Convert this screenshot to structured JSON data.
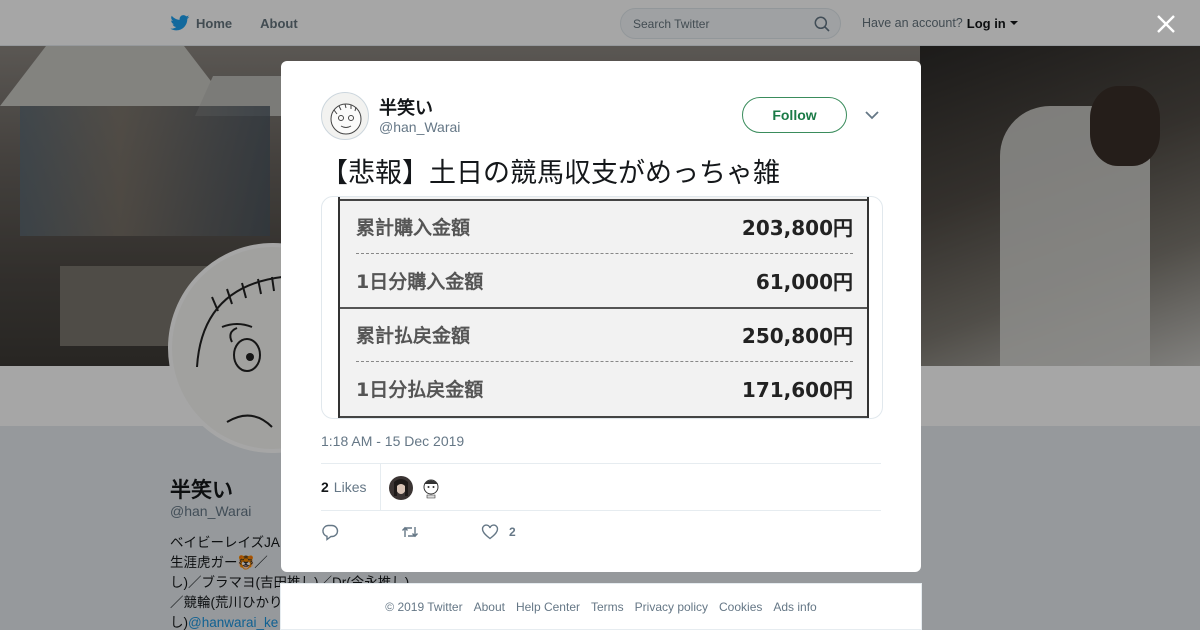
{
  "topbar": {
    "home_label": "Home",
    "about_label": "About",
    "search_placeholder": "Search Twitter",
    "have_account": "Have an account?",
    "login_label": "Log in"
  },
  "profile": {
    "name": "半笑い",
    "handle": "@han_Warai",
    "bio_lines": [
      "ベイビーレイズJA",
      "生涯虎ガー🐯／",
      "し)／ブラマヨ(吉田推し)／Dr(今永推し)",
      "／競輪(荒川ひかり",
      "し)"
    ],
    "bio_link": "@hanwarai_ke"
  },
  "tweet": {
    "author_name": "半笑い",
    "author_handle": "@han_Warai",
    "follow_label": "Follow",
    "text": "【悲報】土日の競馬収支がめっちゃ雑",
    "media_rows": [
      {
        "label": "累計購入金額",
        "value": "203,800円"
      },
      {
        "label": "1日分購入金額",
        "value": "61,000円"
      },
      {
        "label": "累計払戻金額",
        "value": "250,800円"
      },
      {
        "label": "1日分払戻金額",
        "value": "171,600円"
      }
    ],
    "timestamp": "1:18 AM - 15 Dec 2019",
    "likes_count": "2",
    "likes_label": "Likes",
    "like_action_count": "2"
  },
  "footer": {
    "links": [
      "© 2019 Twitter",
      "About",
      "Help Center",
      "Terms",
      "Privacy policy",
      "Cookies",
      "Ads info"
    ]
  },
  "colors": {
    "follow_border": "#3a8c5c",
    "follow_text": "#1a7a46",
    "muted_text": "#657786",
    "link": "#1b95e0",
    "overlay": "rgba(0,0,0,0.35)"
  }
}
